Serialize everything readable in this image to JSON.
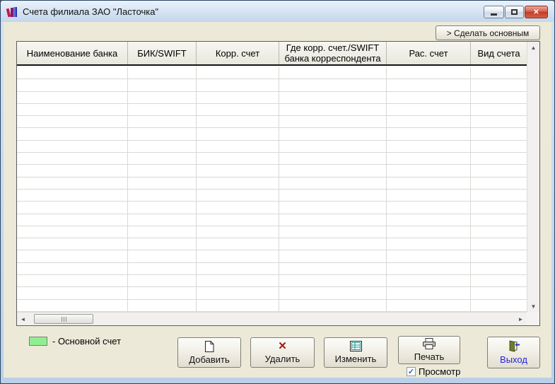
{
  "window": {
    "title": "Счета филиала ЗАО \"Ласточка\"",
    "controls": {
      "close_glyph": "✕"
    }
  },
  "toolbar": {
    "make_primary_label": "> Сделать основным"
  },
  "table": {
    "columns": [
      "Наименование банка",
      "БИК/SWIFT",
      "Корр. счет",
      "Где корр. счет./SWIFT банка корреспондента",
      "Рас. счет",
      "Вид счета"
    ],
    "rows": [],
    "empty_row_count": 20
  },
  "scrollbars": {
    "up_glyph": "▲",
    "down_glyph": "▼",
    "left_glyph": "◄",
    "right_glyph": "►"
  },
  "legend": {
    "label": "- Основной счет",
    "swatch_color": "#90EE90"
  },
  "buttons": {
    "add": "Добавить",
    "delete": "Удалить",
    "edit": "Изменить",
    "print": "Печать",
    "exit": "Выход"
  },
  "preview_checkbox": {
    "label": "Просмотр",
    "checked": true,
    "check_glyph": "✓"
  },
  "colors": {
    "client_bg": "#ECE9D8",
    "primary_row_green": "#90EE90",
    "exit_text": "#2323D6",
    "delete_x": "#9C1D15"
  }
}
